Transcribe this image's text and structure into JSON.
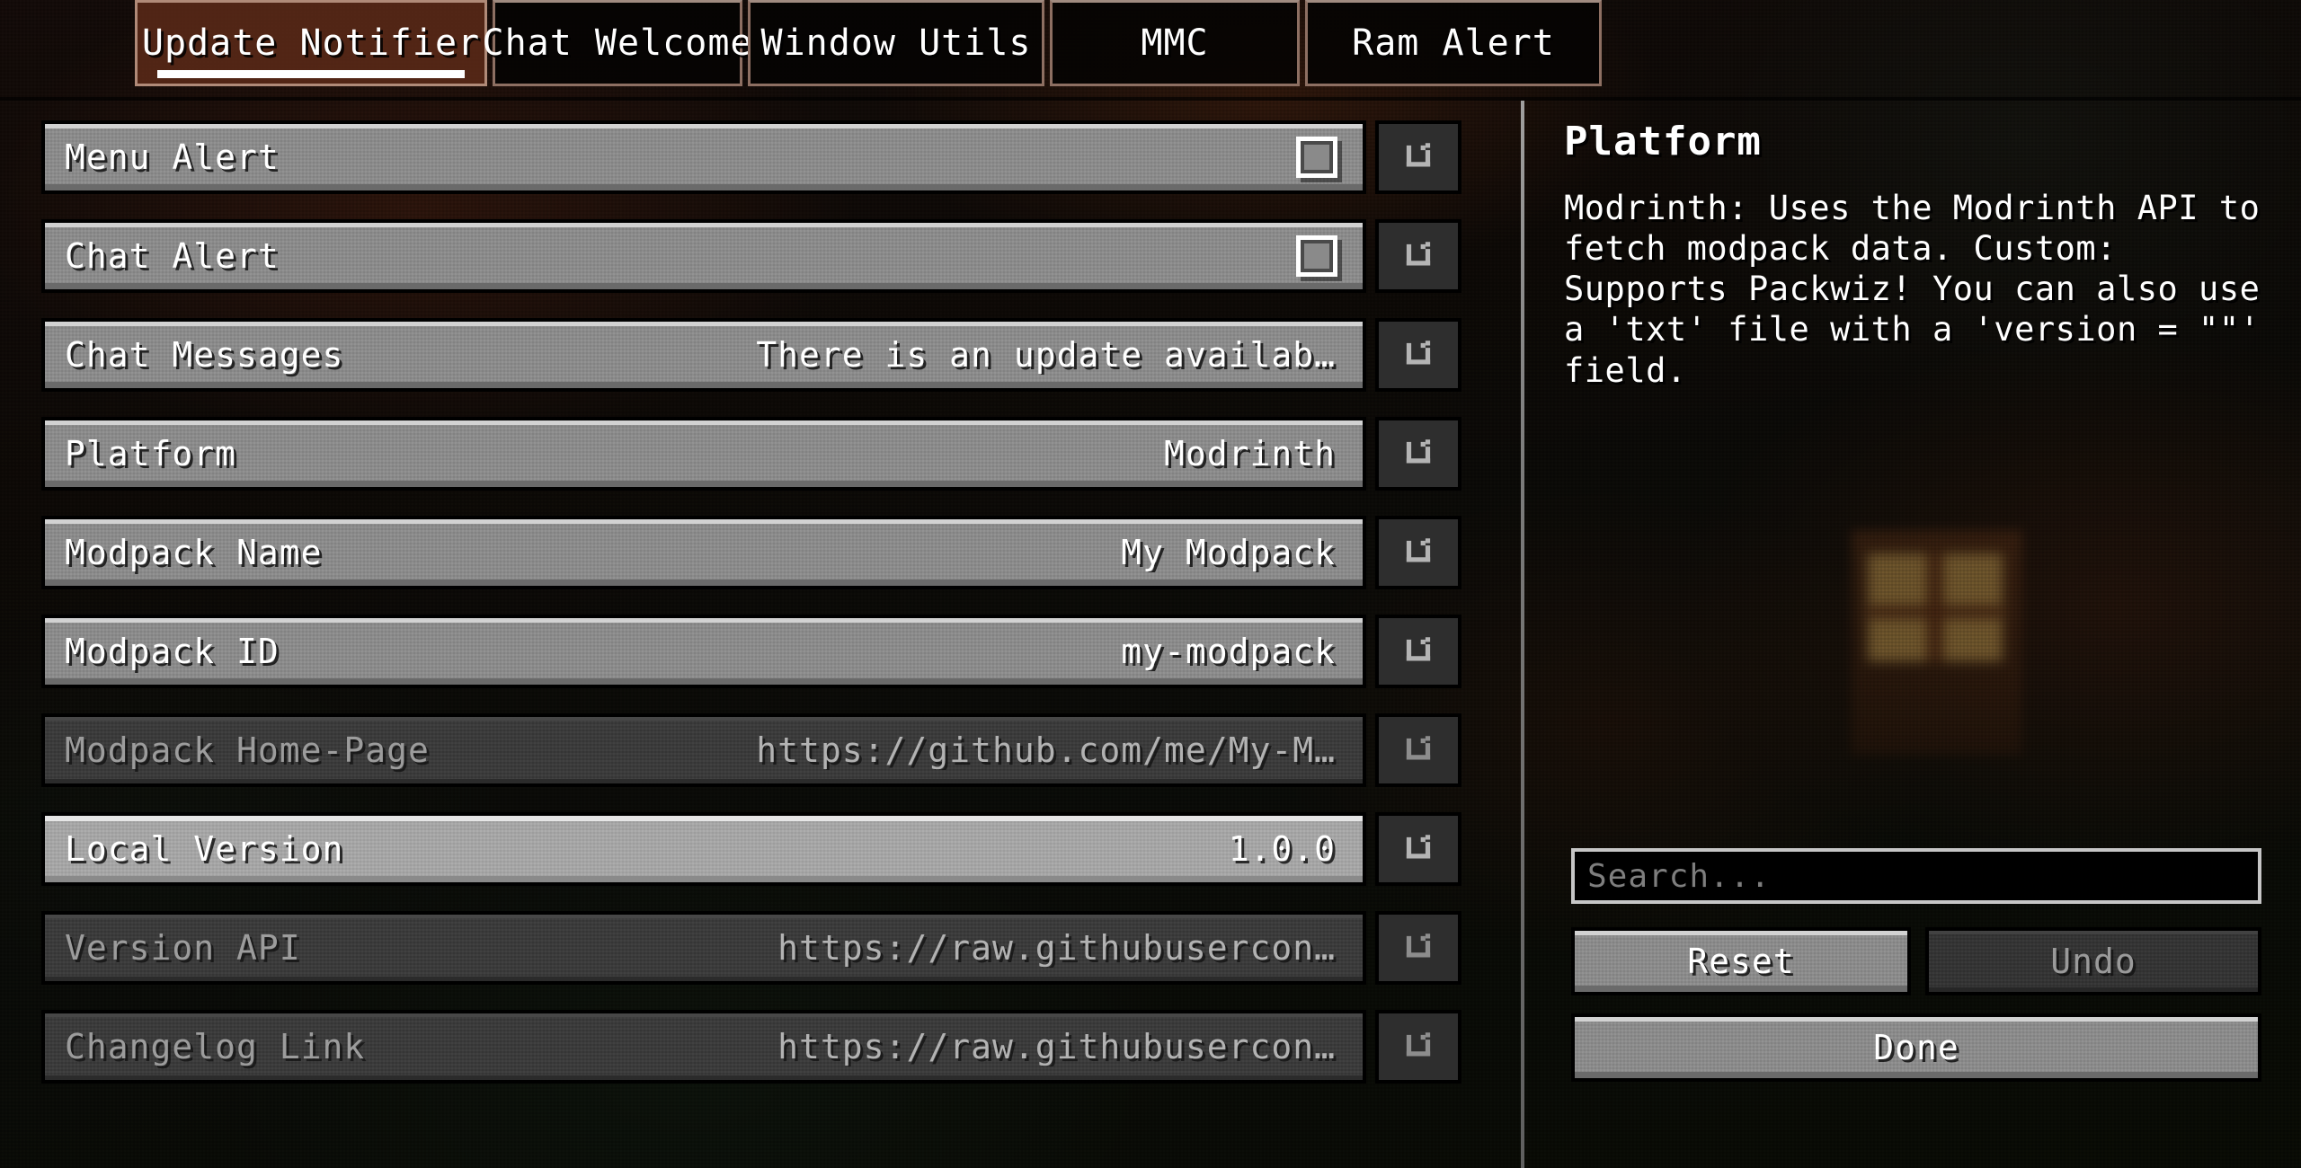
{
  "tabs": [
    {
      "label": "Update Notifier",
      "active": true
    },
    {
      "label": "Chat Welcome",
      "active": false
    },
    {
      "label": "Window Utils",
      "active": false
    },
    {
      "label": "MMC",
      "active": false
    },
    {
      "label": "Ram Alert",
      "active": false
    }
  ],
  "config_rows": [
    {
      "label": "Menu Alert",
      "value": "",
      "type": "checkbox",
      "checked": false,
      "enabled": true,
      "highlight": false
    },
    {
      "label": "Chat Alert",
      "value": "",
      "type": "checkbox",
      "checked": false,
      "enabled": true,
      "highlight": false
    },
    {
      "label": "Chat Messages",
      "value": "There is an update availab…",
      "type": "text",
      "enabled": true,
      "highlight": false
    },
    {
      "label": "Platform",
      "value": "Modrinth",
      "type": "text",
      "enabled": true,
      "highlight": false
    },
    {
      "label": "Modpack Name",
      "value": "My Modpack",
      "type": "text",
      "enabled": true,
      "highlight": false
    },
    {
      "label": "Modpack ID",
      "value": "my-modpack",
      "type": "text",
      "enabled": true,
      "highlight": false
    },
    {
      "label": "Modpack Home-Page",
      "value": "https://github.com/me/My-M…",
      "type": "text",
      "enabled": false,
      "highlight": false
    },
    {
      "label": "Local Version",
      "value": "1.0.0",
      "type": "text",
      "enabled": true,
      "highlight": true
    },
    {
      "label": "Version API",
      "value": "https://raw.githubusercon…",
      "type": "text",
      "enabled": false,
      "highlight": false
    },
    {
      "label": "Changelog Link",
      "value": "https://raw.githubusercon…",
      "type": "text",
      "enabled": false,
      "highlight": false
    }
  ],
  "row_reset_icon": "reset-arrow-icon",
  "info": {
    "title": "Platform",
    "description": "Modrinth: Uses the Modrinth API to fetch modpack data. Custom: Supports Packwiz! You can also use a 'txt' file with a 'version = \"\"' field."
  },
  "search": {
    "placeholder": "Search...",
    "value": ""
  },
  "buttons": {
    "reset": {
      "label": "Reset",
      "enabled": true
    },
    "undo": {
      "label": "Undo",
      "enabled": false
    },
    "done": {
      "label": "Done",
      "enabled": true
    }
  },
  "colors": {
    "entry_enabled": "#8b8b8b",
    "entry_highlight": "#a6a6a6",
    "entry_disabled": "#3a3a3a",
    "text_enabled": "#ffffff",
    "text_disabled": "#9c9c9c",
    "active_tab_underline": "#ffffff",
    "active_tab_bg": "#602c19"
  }
}
